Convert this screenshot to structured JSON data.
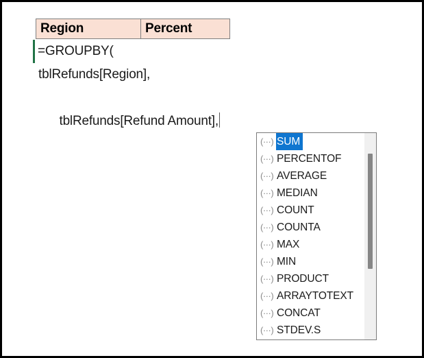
{
  "spreadsheet": {
    "headers": [
      {
        "label": "Region"
      },
      {
        "label": "Percent"
      }
    ],
    "formula_lines": [
      {
        "text": "=GROUPBY("
      },
      {
        "text": "tblRefunds[Region],"
      },
      {
        "text": "tblRefunds[Refund Amount],"
      }
    ]
  },
  "autocomplete": {
    "icon_glyph": "(···)",
    "icon_name": "function-icon",
    "selected": "SUM",
    "items": [
      {
        "label": "SUM",
        "selected": true
      },
      {
        "label": "PERCENTOF",
        "selected": false
      },
      {
        "label": "AVERAGE",
        "selected": false
      },
      {
        "label": "MEDIAN",
        "selected": false
      },
      {
        "label": "COUNT",
        "selected": false
      },
      {
        "label": "COUNTA",
        "selected": false
      },
      {
        "label": "MAX",
        "selected": false
      },
      {
        "label": "MIN",
        "selected": false
      },
      {
        "label": "PRODUCT",
        "selected": false
      },
      {
        "label": "ARRAYTOTEXT",
        "selected": false
      },
      {
        "label": "CONCAT",
        "selected": false
      },
      {
        "label": "STDEV.S",
        "selected": false
      }
    ]
  },
  "colors": {
    "header_fill": "#FAE0D4",
    "header_border": "#7F7F7F",
    "selection_green": "#217346",
    "highlight_blue": "#0F76D0",
    "scrollbar_track": "#F0F0F0",
    "scrollbar_thumb": "#868686",
    "popup_border": "#7A7A7A",
    "text": "#1A1A1A"
  }
}
